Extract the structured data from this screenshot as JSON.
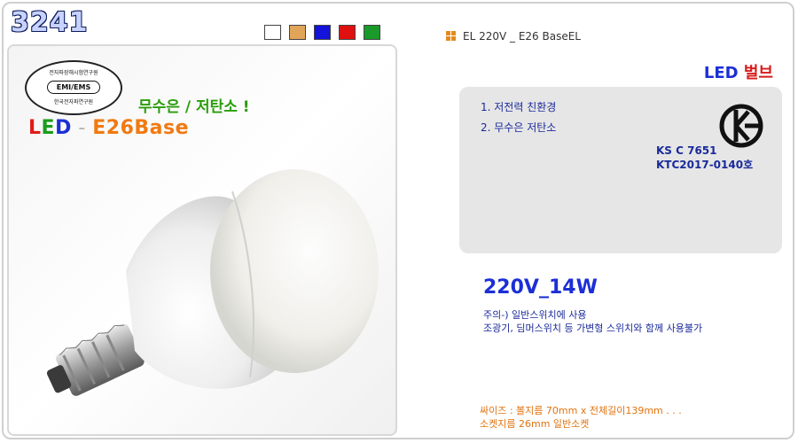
{
  "header": {
    "product_code": "3241",
    "color_swatches": [
      {
        "name": "white",
        "color": "#ffffff"
      },
      {
        "name": "tan",
        "color": "#e1a55a"
      },
      {
        "name": "blue",
        "color": "#1313d9"
      },
      {
        "name": "red",
        "color": "#e01010"
      },
      {
        "name": "green",
        "color": "#1a9a2a"
      }
    ]
  },
  "photo": {
    "cert": {
      "top": "전자파장해시험연구원",
      "middle": "EMI/EMS",
      "bottom": "한국전자파연구원"
    },
    "slogan": "무수은 / 저탄소 !",
    "title_l": "L",
    "title_e": "E",
    "title_d": "D",
    "title_dash": " - ",
    "title_base": "E26Base",
    "bulb_icon": "led-bulb-illustration"
  },
  "specs": {
    "header": "EL 220V _ E26 BaseEL",
    "name_part1": "LED ",
    "name_part2": "벌브",
    "features": [
      "1. 저전력 친환경",
      "2. 무수은 저탄소"
    ],
    "ks_code": "KS C 7651",
    "ktc_code": "KTC2017-0140호",
    "power": "220V_14W",
    "notice_line1": "주의-) 일반스위치에 사용",
    "notice_line2": "조광기, 딤머스위치 등 가변형 스위치와 함께 사용불가",
    "size_line1": "싸이즈 : 볼지름 70mm x 전체길이139mm . . .",
    "size_line2": "소켓지름 26mm 일반소켓"
  },
  "colors": {
    "accent_blue": "#1b2fd6",
    "accent_red": "#d81b1b",
    "accent_orange": "#e0730f",
    "accent_green": "#2a9d0a"
  }
}
